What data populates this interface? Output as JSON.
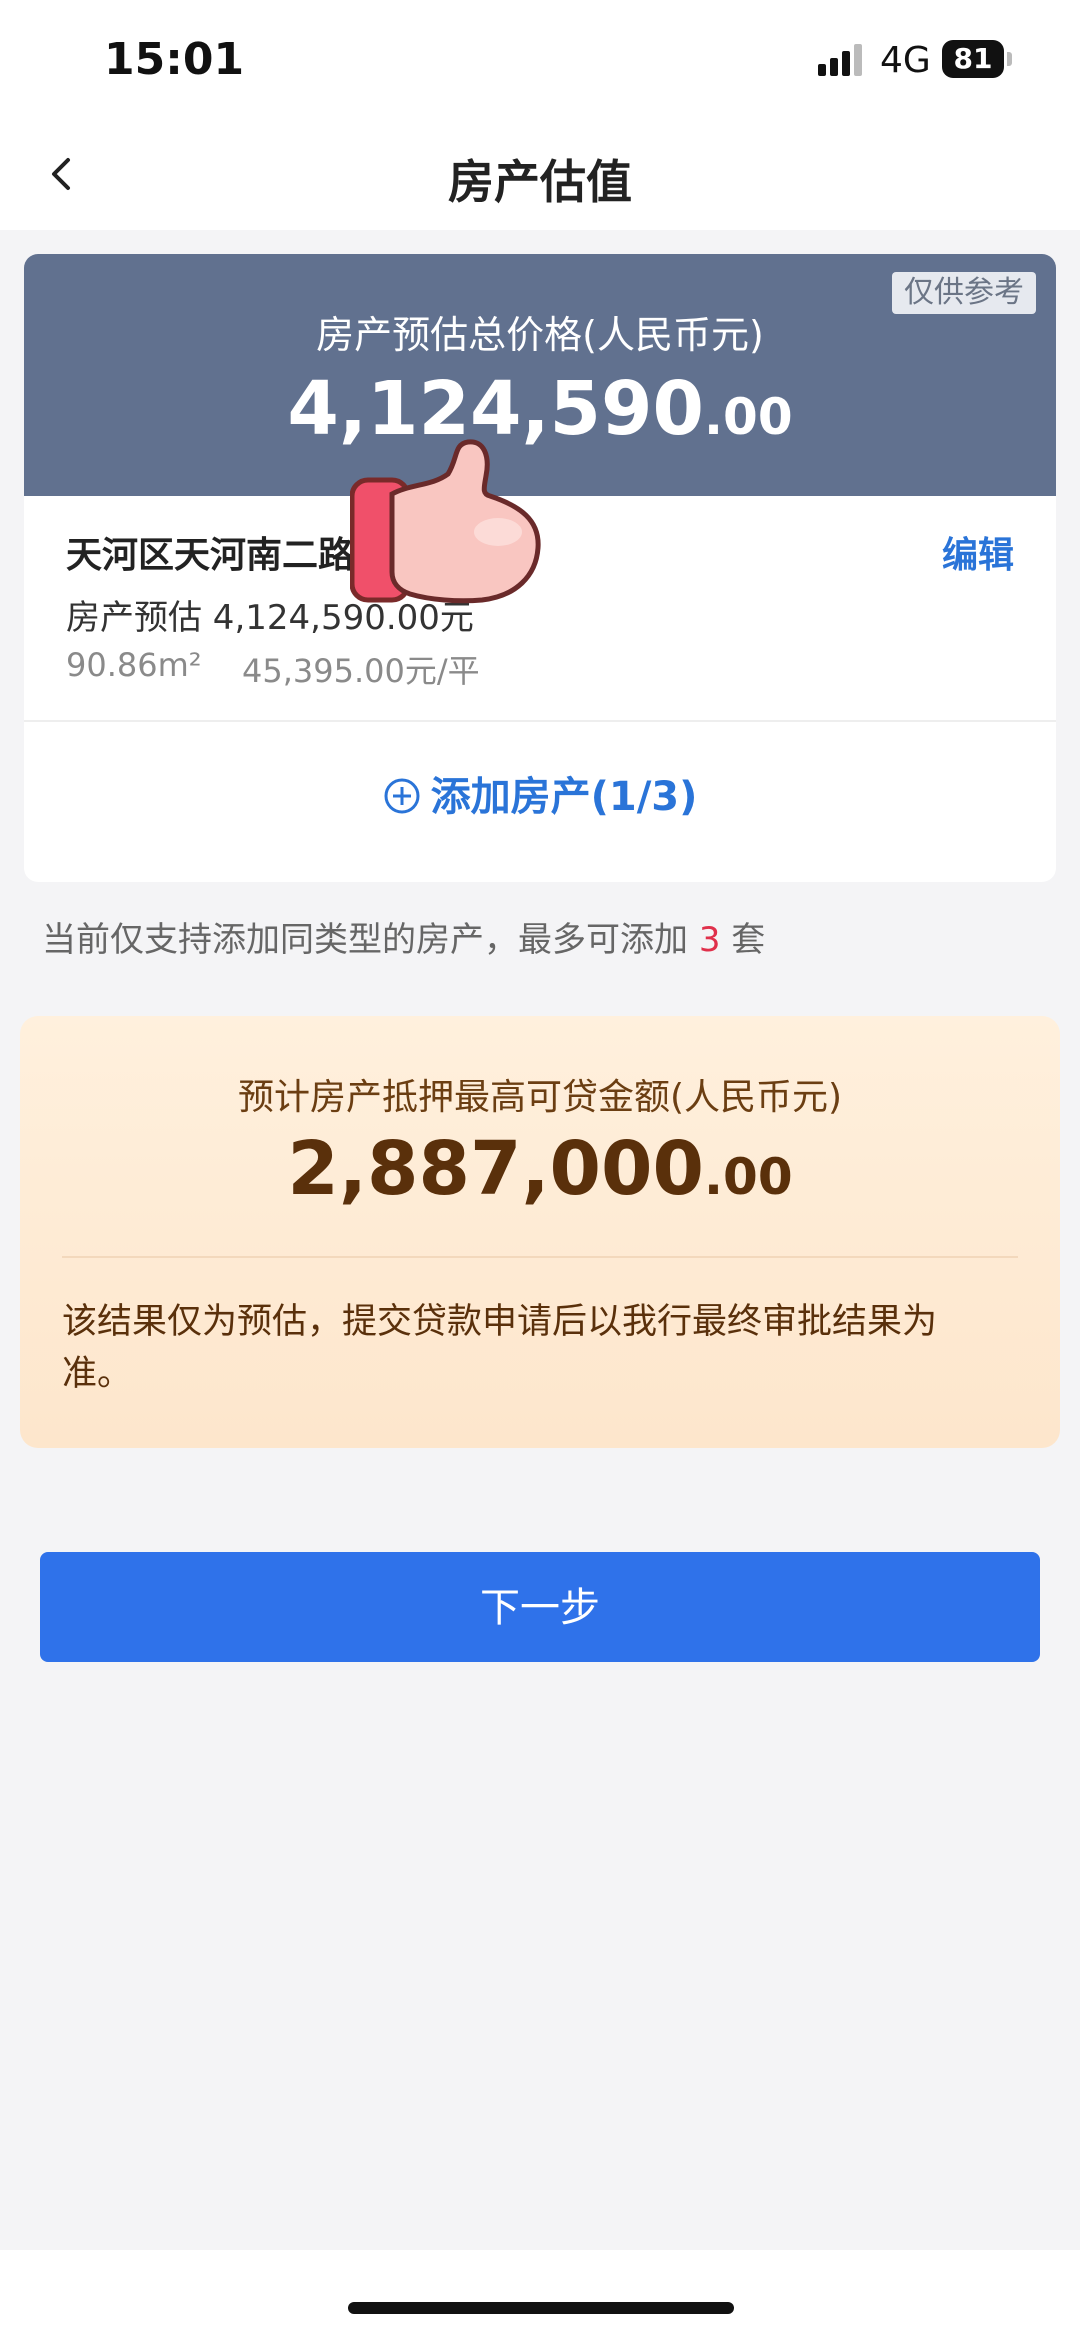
{
  "status_bar": {
    "time": "15:01",
    "network": "4G",
    "battery": "81"
  },
  "nav": {
    "title": "房产估值",
    "back_icon": "chevron-left-icon"
  },
  "valuation": {
    "badge": "仅供参考",
    "label": "房产预估总价格(人民币元)",
    "amount_int": "4,124,590",
    "amount_dec": ".00"
  },
  "property": {
    "address": "天河区天河南二路",
    "edit_label": "编辑",
    "valuation_text": "房产预估 4,124,590.00元",
    "area": "90.86m²",
    "unit_price": "45,395.00元/平"
  },
  "add_property": {
    "icon": "plus-circle-icon",
    "label": "添加房产(1/3)"
  },
  "notice": {
    "prefix": "当前仅支持添加同类型的房产，最多可添加 ",
    "count": "3",
    "suffix": " 套"
  },
  "loan": {
    "label": "预计房产抵押最高可贷金额(人民币元)",
    "amount_int": "2,887,000",
    "amount_dec": ".00",
    "note": "该结果仅为预估，提交贷款申请后以我行最终审批结果为准。"
  },
  "next_button": {
    "label": "下一步"
  },
  "overlay": {
    "icon": "thumbs-up-icon"
  },
  "colors": {
    "primary": "#2f72ea",
    "link": "#2a74d8",
    "header": "#61718f",
    "highlight": "#e0304b",
    "loan_text": "#5a300b"
  }
}
